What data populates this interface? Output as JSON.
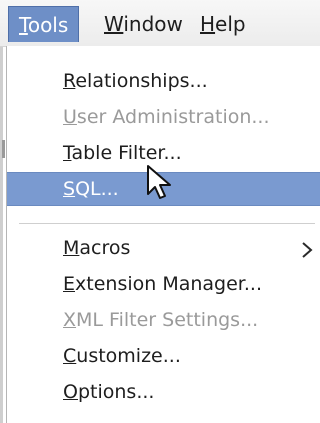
{
  "menubar": {
    "items": [
      {
        "mnemonic": "T",
        "rest": "ools",
        "active": true
      },
      {
        "mnemonic": "W",
        "rest": "indow",
        "active": false
      },
      {
        "mnemonic": "H",
        "rest": "elp",
        "active": false
      }
    ]
  },
  "tools_menu": {
    "items": [
      {
        "mnemonic": "R",
        "rest": "elationships...",
        "enabled": true
      },
      {
        "mnemonic": "U",
        "rest": "ser Administration...",
        "enabled": false
      },
      {
        "mnemonic": "T",
        "rest": "able Filter...",
        "enabled": true
      },
      {
        "mnemonic": "S",
        "rest": "QL...",
        "enabled": true,
        "highlighted": true
      },
      {
        "mnemonic": "M",
        "rest": "acros",
        "enabled": true,
        "submenu_glyph": "›"
      },
      {
        "mnemonic": "E",
        "rest": "xtension Manager...",
        "enabled": true
      },
      {
        "mnemonic": "X",
        "rest": "ML Filter Settings...",
        "enabled": false
      },
      {
        "mnemonic": "C",
        "rest": "ustomize...",
        "enabled": true
      },
      {
        "mnemonic": "O",
        "rest": "ptions...",
        "enabled": true
      }
    ]
  },
  "colors": {
    "highlight": "#7a9ad0",
    "menubar_active": "#6e8fc7",
    "disabled_text": "#9a9a9a"
  },
  "icons": {
    "cursor": "arrow-cursor-icon",
    "submenu": "chevron-right-icon"
  }
}
